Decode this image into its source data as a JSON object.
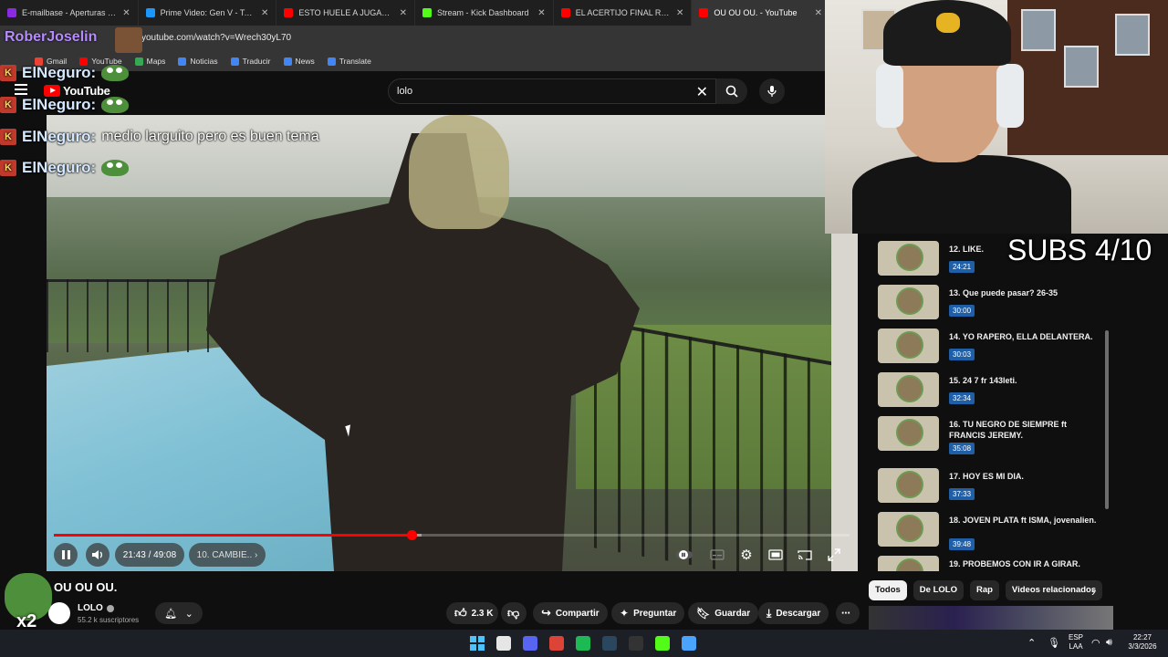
{
  "browser": {
    "tabs": [
      {
        "title": "E-mailbase - Aperturas cajas",
        "color": "#8a2be2",
        "active": false
      },
      {
        "title": "Prime Video: Gen V - Temporada",
        "color": "#1a98ff",
        "active": false
      },
      {
        "title": "ESTO HUELE A JUGAZO PARA",
        "color": "#ff0000",
        "active": false
      },
      {
        "title": "Stream - Kick Dashboard",
        "color": "#53fc18",
        "active": false
      },
      {
        "title": "EL ACERTIJO FINAL RESUELTO y",
        "color": "#ff0000",
        "active": false
      },
      {
        "title": "OU OU OU. - YouTube",
        "color": "#ff0000",
        "active": true
      }
    ],
    "url": "youtube.com/watch?v=Wrech30yL70",
    "bookmarks": [
      {
        "label": "Gmail",
        "color": "#ea4335"
      },
      {
        "label": "YouTube",
        "color": "#ff0000"
      },
      {
        "label": "Maps",
        "color": "#34a853"
      },
      {
        "label": "Noticias",
        "color": "#4285f4"
      },
      {
        "label": "Traducir",
        "color": "#4285f4"
      },
      {
        "label": "News",
        "color": "#4285f4"
      },
      {
        "label": "Translate",
        "color": "#4285f4"
      }
    ]
  },
  "youtube": {
    "logo": "YouTube",
    "search_value": "lolo",
    "player": {
      "time": "21:43 / 49:08",
      "chapter": "10. CAMBIE..",
      "progress": 0.449,
      "buffered": 0.462
    },
    "video_title": "OU OU OU.",
    "channel": {
      "name": "LOLO",
      "subscribers": "55.2 k suscriptores"
    },
    "actions": {
      "likes": "2.3 K",
      "share": "Compartir",
      "ask": "Preguntar",
      "save": "Guardar",
      "download": "Descargar"
    },
    "playlist": [
      {
        "title": "12. LIKE.",
        "duration": "24:21"
      },
      {
        "title": "13. Que puede pasar? 26-35",
        "duration": "30:00"
      },
      {
        "title": "14. YO RAPERO, ELLA DELANTERA.",
        "duration": "30:03"
      },
      {
        "title": "15. 24 7 fr 143leti.",
        "duration": "32:34"
      },
      {
        "title": "16. TU NEGRO DE SIEMPRE ft FRANCIS JEREMY.",
        "duration": "35:08"
      },
      {
        "title": "17. HOY ES MI DIA.",
        "duration": "37:33"
      },
      {
        "title": "18. JOVEN PLATA ft ISMA, jovenalien.",
        "duration": "39:48"
      },
      {
        "title": "19. PROBEMOS CON IR A GIRAR.",
        "duration": ""
      }
    ],
    "chips": [
      "Todos",
      "De LOLO",
      "Rap",
      "Videos relacionados"
    ]
  },
  "overlay": {
    "top_chatter": "RoberJoselin",
    "chat": [
      {
        "user": "ElNeguro:",
        "message": "",
        "emote": true
      },
      {
        "user": "ElNeguro:",
        "message": "",
        "emote": true
      },
      {
        "user": "ElNeguro:",
        "message": "medio larguito pero es buen tema",
        "emote": false
      },
      {
        "user": "ElNeguro:",
        "message": "",
        "emote": true
      }
    ],
    "subs_counter": "SUBS 4/10",
    "emote_multiplier": "x2"
  },
  "taskbar": {
    "lang": "ESP",
    "region": "LAA",
    "time": "22:27",
    "date": "3/3/2026",
    "icons": [
      {
        "name": "github-icon",
        "color": "#e6e6e6"
      },
      {
        "name": "discord-icon",
        "color": "#5865f2"
      },
      {
        "name": "chrome-icon",
        "color": "#db4437"
      },
      {
        "name": "spotify-icon",
        "color": "#1db954"
      },
      {
        "name": "steam-icon",
        "color": "#2a475e"
      },
      {
        "name": "epic-games-icon",
        "color": "#333333"
      },
      {
        "name": "kick-icon",
        "color": "#53fc18"
      },
      {
        "name": "notepad-icon",
        "color": "#4aa3ff"
      }
    ]
  }
}
